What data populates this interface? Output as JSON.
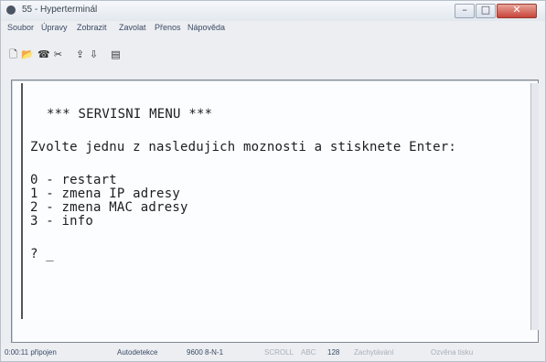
{
  "window": {
    "title": "55 - Hyperterminál",
    "controls": {
      "minimize": "–",
      "maximize": "□",
      "close": "✕"
    }
  },
  "menu": [
    "Soubor",
    "Úpravy",
    "Zobrazit",
    "Zavolat",
    "Přenos",
    "Nápověda"
  ],
  "toolbar": {
    "icons": [
      "new-connection-icon",
      "open-icon",
      "call-icon",
      "disconnect-icon",
      "send-icon",
      "receive-icon",
      "properties-icon"
    ]
  },
  "terminal": {
    "lines": [
      "*** SERVISNI MENU ***",
      "Zvolte jednu z nasledujich moznosti a stisknete Enter:",
      "0 - restart",
      "1 - zmena IP adresy",
      "2 - zmena MAC adresy",
      "3 - info",
      "? _"
    ]
  },
  "status": {
    "time": "0:00:11 připojen",
    "emulation": "Autodetekce",
    "port_settings": "9600 8-N-1",
    "scroll": "SCROLL",
    "caps": "ABC",
    "num": "128",
    "capture": "Zachytávání",
    "print_echo": "Ozvěna tisku"
  }
}
